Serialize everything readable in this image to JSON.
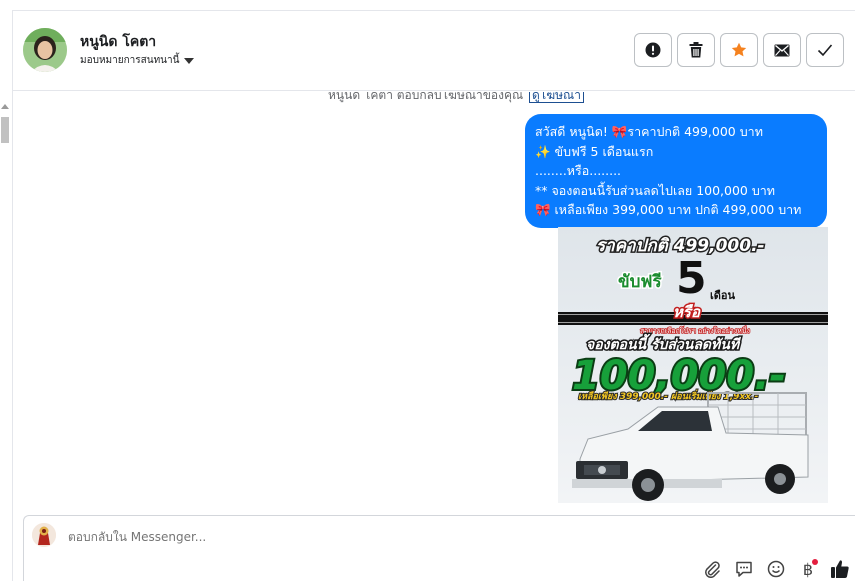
{
  "header": {
    "contact_name": "หนูนิด โคตา",
    "assign_label": "มอบหมายการสนทนานี้",
    "actions": [
      {
        "name": "mark-spam",
        "icon": "exclamation-circle-icon"
      },
      {
        "name": "delete",
        "icon": "trash-icon"
      },
      {
        "name": "star",
        "icon": "star-icon"
      },
      {
        "name": "mark-unread",
        "icon": "envelope-icon"
      },
      {
        "name": "done",
        "icon": "checkmark-icon"
      }
    ]
  },
  "chat": {
    "clipped_note": "หนูนิด โคตา ตอบกลับโฆษณาของคุณ",
    "clipped_link": "ดูโฆษณา",
    "message_lines": [
      "สวัสดี หนูนิด!  🎀ราคาปกติ 499,000 บาท",
      "✨ ขับฟรี 5 เดือนแรก",
      "........หรือ........",
      "** จองตอนนี้รับส่วนลดไปเลย 100,000 บาท",
      "🎀 เหลือเพียง 399,000 บาท ปกติ 499,000 บาท"
    ],
    "promo_image": {
      "line_price": "ราคาปกติ 499,000.-",
      "line_drive_free": "ขับฟรี",
      "line_five": "5",
      "line_month": "เดือน",
      "line_or": "หรือ",
      "line_choose": "สามารถเลือกโปรฯ อย่างใดอย่างหนึ่ง",
      "line_book": "จองตอนนี้ รับส่วนลดทันที",
      "line_discount": "100,000.-",
      "line_remaining": "เหลือเพียง 399,000.-  ผ่อนเริ่มเพียง 1,9xx.-"
    }
  },
  "composer": {
    "placeholder": "ตอบกลับใน Messenger..."
  },
  "colors": {
    "bubble": "#0a7cff",
    "star": "#f5821f",
    "badge": "#e41e3f"
  }
}
